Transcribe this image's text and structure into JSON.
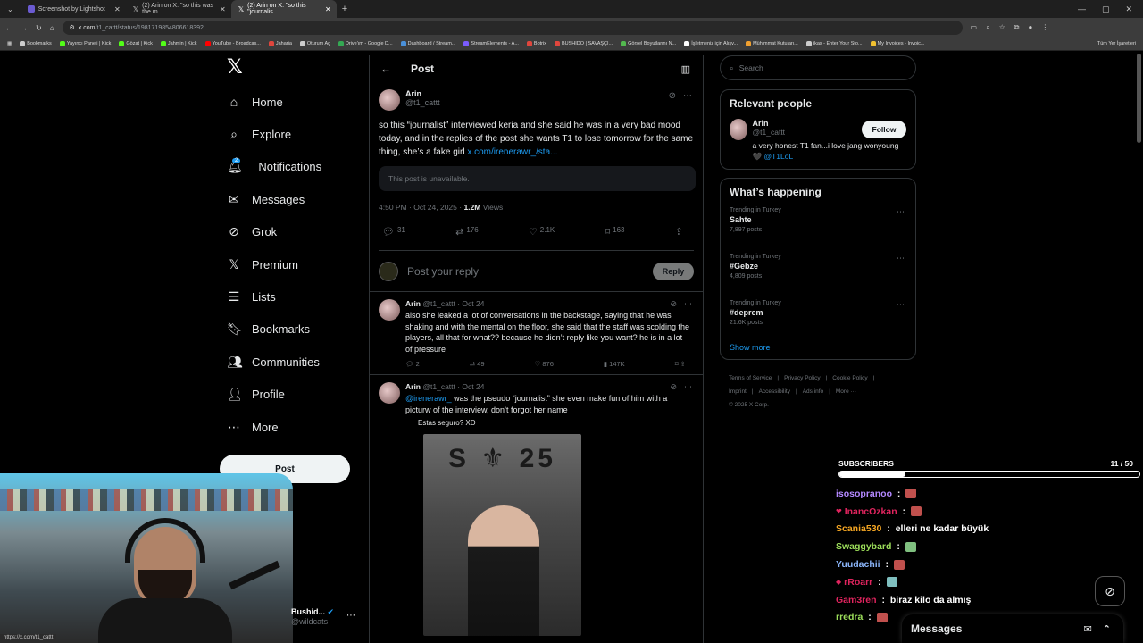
{
  "browser": {
    "tabs": [
      {
        "title": "Screenshot by Lightshot",
        "active": false,
        "color": "#6b5bd2"
      },
      {
        "title": "(2) Arin on X: \"so this was the m",
        "active": false,
        "color": "#ffffff"
      },
      {
        "title": "(2) Arin on X: \"so this \"journalis",
        "active": true,
        "color": "#ffffff"
      }
    ],
    "new_tab": "+",
    "url_host": "x.com",
    "url_path": "/t1_cattt/status/1981719854806618392",
    "bookmarks": [
      {
        "label": "Bookmarks",
        "color": "#cccccc"
      },
      {
        "label": "Yayıncı Paneli | Kick",
        "color": "#53fc18"
      },
      {
        "label": "Gözat | Kick",
        "color": "#53fc18"
      },
      {
        "label": "Jahmin | Kick",
        "color": "#53fc18"
      },
      {
        "label": "YouTube - Broadcas...",
        "color": "#ff0000"
      },
      {
        "label": "Jaharia",
        "color": "#e0463d"
      },
      {
        "label": "Oturum Aç",
        "color": "#cccccc"
      },
      {
        "label": "Drive'ım - Google D...",
        "color": "#34a853"
      },
      {
        "label": "Dashboard / Stream...",
        "color": "#4a90d9"
      },
      {
        "label": "StreamElements - A...",
        "color": "#7b5cff"
      },
      {
        "label": "Botrix",
        "color": "#e0463d"
      },
      {
        "label": "BUSHIDO | SAVAŞÇI...",
        "color": "#e0463d"
      },
      {
        "label": "Görsel Boyutlarını N...",
        "color": "#53b84f"
      },
      {
        "label": "İşletmeniz için Alışv...",
        "color": "#ffffff"
      },
      {
        "label": "Mühimmat Kutuları...",
        "color": "#f0a030"
      },
      {
        "label": "ikas - Enter Your Sto...",
        "color": "#cccccc"
      },
      {
        "label": "My Invoices - Invoic...",
        "color": "#f0c030"
      }
    ],
    "bookmarks_right": "Tüm Yer İşaretleri",
    "status_url": "https://x.com/t1_cattt"
  },
  "nav": {
    "logo": "𝕏",
    "items": [
      {
        "label": "Home",
        "icon": "home-icon",
        "glyph": "⌂"
      },
      {
        "label": "Explore",
        "icon": "search-icon",
        "glyph": "⌕"
      },
      {
        "label": "Notifications",
        "icon": "bell-icon",
        "glyph": "🔔︎",
        "badge": "2"
      },
      {
        "label": "Messages",
        "icon": "mail-icon",
        "glyph": "✉"
      },
      {
        "label": "Grok",
        "icon": "grok-icon",
        "glyph": "⊘"
      },
      {
        "label": "Premium",
        "icon": "x-premium-icon",
        "glyph": "𝕏"
      },
      {
        "label": "Lists",
        "icon": "list-icon",
        "glyph": "☰"
      },
      {
        "label": "Bookmarks",
        "icon": "bookmark-icon",
        "glyph": "🔖︎"
      },
      {
        "label": "Communities",
        "icon": "communities-icon",
        "glyph": "👥︎"
      },
      {
        "label": "Profile",
        "icon": "profile-icon",
        "glyph": "👤︎"
      },
      {
        "label": "More",
        "icon": "more-icon",
        "glyph": "⋯"
      }
    ],
    "post_button": "Post",
    "account_name": "Bushid...",
    "account_handle": "@wildcats"
  },
  "post": {
    "header_title": "Post",
    "author_name": "Arin",
    "author_handle": "@t1_cattt",
    "text": "so this “journalist” interviewed keria and she said he was in a very bad mood today, and in the replies of the post she wants T1 to lose tomorrow for the same thing, she’s a fake girl ",
    "link": "x.com/irenerawr_/sta...",
    "unavailable": "This post is unavailable.",
    "timestamp": "4:50 PM · Oct 24, 2025 · ",
    "views_count": "1.2M",
    "views_label": " Views",
    "stats": {
      "replies": "31",
      "reposts": "176",
      "likes": "2.1K",
      "bookmarks": "163"
    },
    "reply_placeholder": "Post your reply",
    "reply_button": "Reply"
  },
  "replies": [
    {
      "name": "Arin",
      "handle": "@t1_cattt · Oct 24",
      "mention": "",
      "text": "also she leaked a lot of conversations in the backstage, saying that he was shaking and with the mental on the floor, she said that the staff was scolding the players, all that for what?? because he didn’t reply like you want? he is in a lot of pressure",
      "stats": {
        "replies": "2",
        "reposts": "49",
        "likes": "876",
        "views": "147K"
      }
    },
    {
      "name": "Arin",
      "handle": "@t1_cattt · Oct 24",
      "mention": "@irenerawr_",
      "text": " was the pseudo “journalist” she even make fun of him with a picturw of the interview, don’t forgot her name",
      "quote_label": "Estas seguro? XD"
    }
  ],
  "right": {
    "search_placeholder": "Search",
    "relevant_title": "Relevant people",
    "person": {
      "name": "Arin",
      "handle": "@t1_cattt",
      "bio": "a very honest T1 fan...i love jang wonyoung 🖤 ",
      "bio_link": "@T1LoL",
      "follow": "Follow"
    },
    "happening_title": "What’s happening",
    "trends": [
      {
        "context": "Trending in Turkey",
        "name": "Sahte",
        "count": "7,897 posts"
      },
      {
        "context": "Trending in Turkey",
        "name": "#Gebze",
        "count": "4,809 posts"
      },
      {
        "context": "Trending in Turkey",
        "name": "#deprem",
        "count": "21.6K posts"
      }
    ],
    "show_more": "Show more",
    "footer": [
      "Terms of Service",
      "|",
      "Privacy Policy",
      "|",
      "Cookie Policy",
      "|",
      "Imprint",
      "|",
      "Accessibility",
      "|",
      "Ads info",
      "|",
      "More ···",
      "© 2025 X Corp."
    ]
  },
  "overlay": {
    "subs_label": "SUBSCRIBERS",
    "subs_count": "11",
    "subs_total": "/ 50",
    "subs_progress": 0.22,
    "chat": [
      {
        "user": "isosopranoo",
        "color": "#b388ff",
        "msg": "",
        "emote": "#c0504d"
      },
      {
        "user": "InancOzkan",
        "color": "#e0245e",
        "msg": "",
        "emote": "#c0504d",
        "prefix": "❤"
      },
      {
        "user": "Scania530",
        "color": "#f5a623",
        "msg": "elleri ne kadar büyük",
        "emote": ""
      },
      {
        "user": "Swaggybard",
        "color": "#9cde5a",
        "msg": "",
        "emote": "#7fbf7f"
      },
      {
        "user": "Yuudachii",
        "color": "#8ab4f8",
        "msg": "",
        "emote": "#c0504d"
      },
      {
        "user": "rRoarr",
        "color": "#e0245e",
        "msg": "",
        "emote": "#7fbfbf",
        "prefix": "◆"
      },
      {
        "user": "Gam3ren",
        "color": "#e0245e",
        "msg": "biraz kilo da almış",
        "emote": ""
      },
      {
        "user": "rredra",
        "color": "#9cde5a",
        "msg": "",
        "emote": "#c0504d"
      }
    ],
    "messages_drawer": "Messages"
  }
}
